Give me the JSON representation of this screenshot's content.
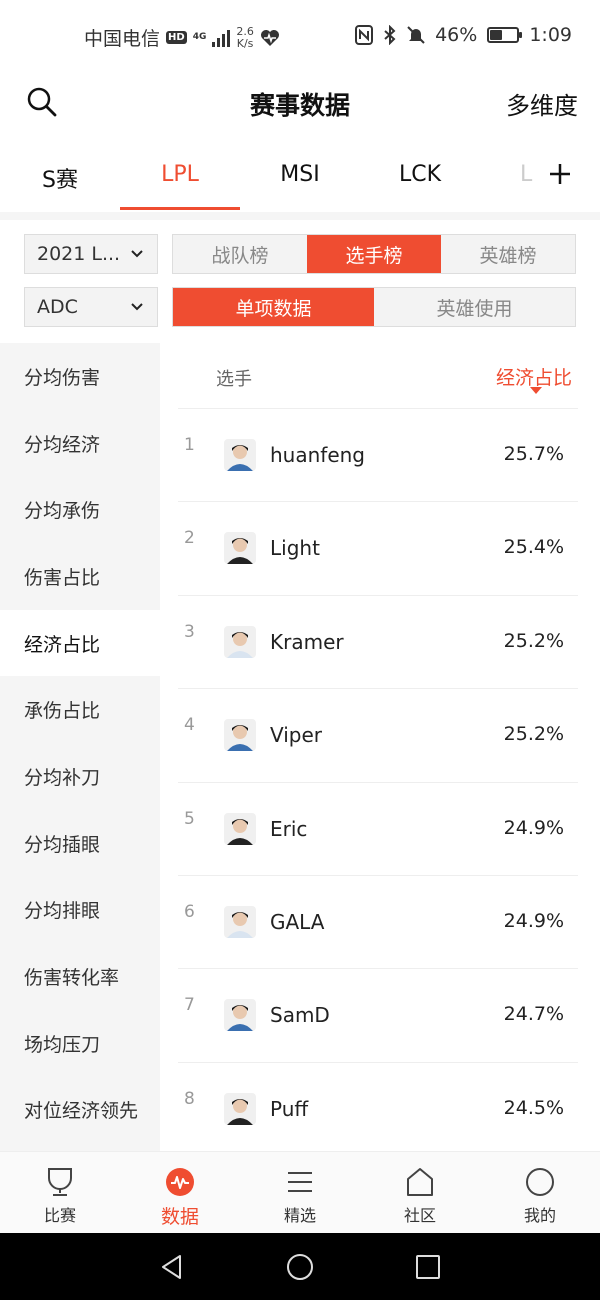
{
  "status_bar": {
    "carrier": "中国电信",
    "hd_badge": "HD",
    "network": "4G",
    "speed_value": "2.6",
    "speed_unit": "K/s",
    "battery": "46%",
    "battery_level": 0.46,
    "time": "1:09"
  },
  "header": {
    "title": "赛事数据",
    "right_label": "多维度"
  },
  "league_tabs": [
    {
      "label": "S赛"
    },
    {
      "label": "LPL",
      "active": true
    },
    {
      "label": "MSI"
    },
    {
      "label": "LCK"
    },
    {
      "label": "L"
    }
  ],
  "filters": {
    "season": "2021 L...",
    "position": "ADC",
    "ranking_tabs": [
      "战队榜",
      "选手榜",
      "英雄榜"
    ],
    "ranking_active": 1,
    "data_tabs": [
      "单项数据",
      "英雄使用"
    ],
    "data_active": 0
  },
  "stat_menu": [
    "分均伤害",
    "分均经济",
    "分均承伤",
    "伤害占比",
    "经济占比",
    "承伤占比",
    "分均补刀",
    "分均插眼",
    "分均排眼",
    "伤害转化率",
    "场均压刀",
    "对位经济领先"
  ],
  "stat_menu_active": 4,
  "table": {
    "col_player": "选手",
    "col_stat": "经济占比",
    "rows": [
      {
        "rank": "1",
        "player": "huanfeng",
        "value": "25.7%"
      },
      {
        "rank": "2",
        "player": "Light",
        "value": "25.4%"
      },
      {
        "rank": "3",
        "player": "Kramer",
        "value": "25.2%"
      },
      {
        "rank": "4",
        "player": "Viper",
        "value": "25.2%"
      },
      {
        "rank": "5",
        "player": "Eric",
        "value": "24.9%"
      },
      {
        "rank": "6",
        "player": "GALA",
        "value": "24.9%"
      },
      {
        "rank": "7",
        "player": "SamD",
        "value": "24.7%"
      },
      {
        "rank": "8",
        "player": "Puff",
        "value": "24.5%"
      }
    ]
  },
  "bottom_nav": [
    {
      "label": "比赛",
      "icon": "trophy-icon"
    },
    {
      "label": "数据",
      "icon": "data-pulse-icon",
      "active": true
    },
    {
      "label": "精选",
      "icon": "list-icon"
    },
    {
      "label": "社区",
      "icon": "community-icon"
    },
    {
      "label": "我的",
      "icon": "profile-icon"
    }
  ],
  "colors": {
    "accent": "#ef4d31",
    "menu_bg": "#f5f5f5"
  }
}
